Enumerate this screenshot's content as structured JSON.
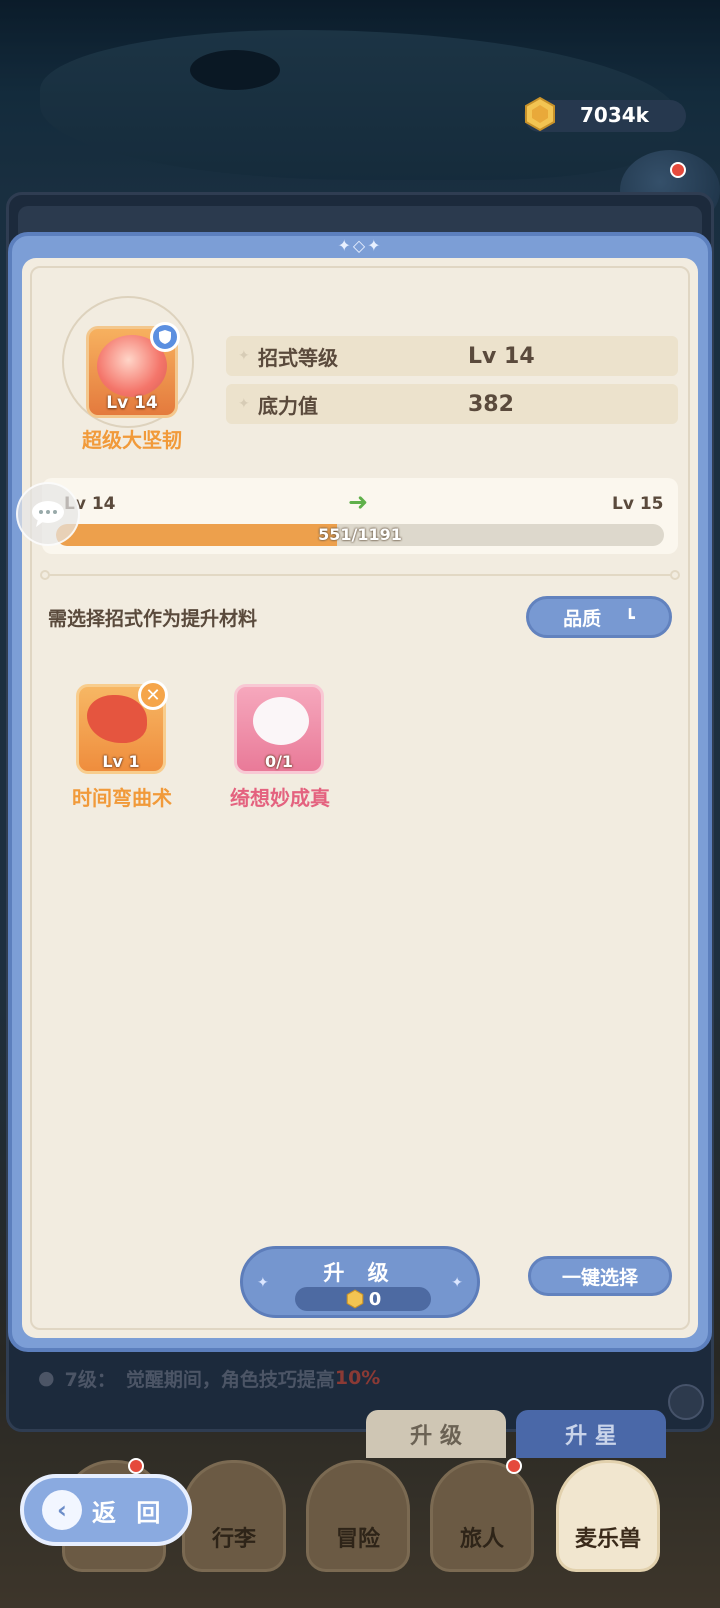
{
  "currency": {
    "icon": "gold-coin-icon",
    "value": "7034k"
  },
  "skill": {
    "icon": "skill-icon",
    "level_badge": "Lv 14",
    "name": "超级大坚韧",
    "stats": [
      {
        "label": "招式等级",
        "value": "Lv 14"
      },
      {
        "label": "底力值",
        "value": "382"
      }
    ]
  },
  "progress": {
    "from_level": "Lv 14",
    "to_level": "Lv 15",
    "current": 551,
    "total": 1191,
    "text": "551/1191"
  },
  "materials": {
    "hint": "需选择招式作为提升材料",
    "quality_button": "品质",
    "items": [
      {
        "name": "时间弯曲术",
        "badge": "Lv 1",
        "color": "#f19a3a"
      },
      {
        "name": "绮想妙成真",
        "badge": "0/1",
        "color": "#e4627f"
      }
    ]
  },
  "upgrade": {
    "label": "升 级",
    "cost": "0"
  },
  "auto_select": "一键选择",
  "background": {
    "info_prefix": "7级：",
    "info_text": "觉醒期间，角色技巧提高",
    "info_pct": "10%",
    "tabs": [
      "升 级",
      "升 星"
    ]
  },
  "nav": {
    "back": "返 回",
    "items": [
      "行李",
      "冒险",
      "旅人",
      "麦乐兽"
    ]
  }
}
